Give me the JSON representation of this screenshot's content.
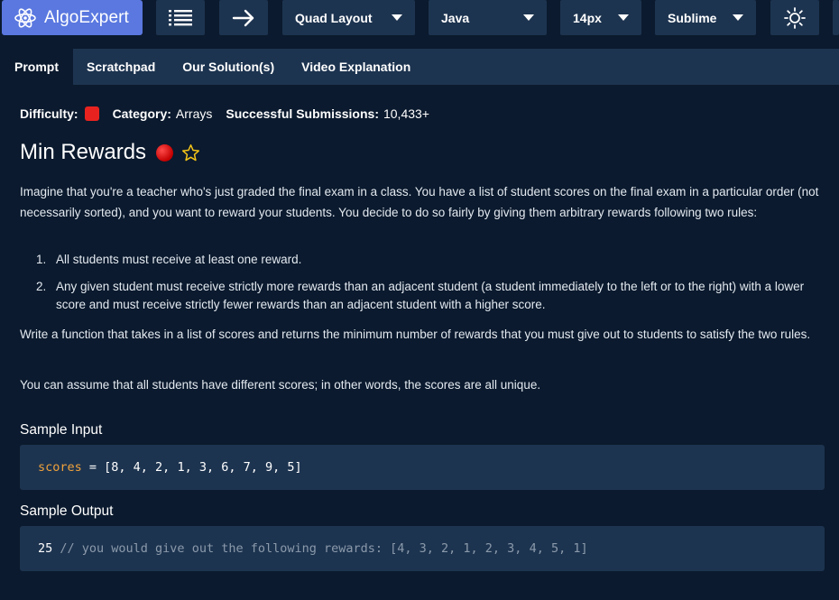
{
  "toolbar": {
    "brand": "AlgoExpert",
    "layout": "Quad Layout",
    "language": "Java",
    "font_size": "14px",
    "keymap": "Sublime"
  },
  "tabs": [
    "Prompt",
    "Scratchpad",
    "Our Solution(s)",
    "Video Explanation"
  ],
  "meta": {
    "difficulty_label": "Difficulty:",
    "category_label": "Category:",
    "category_value": "Arrays",
    "submissions_label": "Successful Submissions:",
    "submissions_value": "10,433+",
    "difficulty_color": "#e8231f"
  },
  "problem": {
    "title": "Min Rewards",
    "para1": "Imagine that you're a teacher who's just graded the final exam in a class. You have a list of student scores on the final exam in a particular order (not necessarily sorted), and you want to reward your students. You decide to do so fairly by giving them arbitrary rewards following two rules:",
    "rules": [
      {
        "num": "1.",
        "text": "All students must receive at least one reward."
      },
      {
        "num": "2.",
        "text": "Any given student must receive strictly more rewards than an adjacent student (a student immediately to the left or to the right) with a lower score and must receive strictly fewer rewards than an adjacent student with a higher score."
      }
    ],
    "para2": "Write a function that takes in a list of scores and returns the minimum number of rewards that you must give out to students to satisfy the two rules.",
    "para3": "You can assume that all students have different scores; in other words, the scores are all unique."
  },
  "sample_input": {
    "heading": "Sample Input",
    "var": "scores",
    "rest": " = [8, 4, 2, 1, 3, 6, 7, 9, 5]"
  },
  "sample_output": {
    "heading": "Sample Output",
    "value": "25",
    "comment": " // you would give out the following rewards: [4, 3, 2, 1, 2, 3, 4, 5, 1]"
  },
  "colors": {
    "accent": "#5a78e0",
    "panel": "#1d3450",
    "background": "#0b1a2e",
    "keyword": "#f0a23b",
    "star": "#f5c518"
  }
}
